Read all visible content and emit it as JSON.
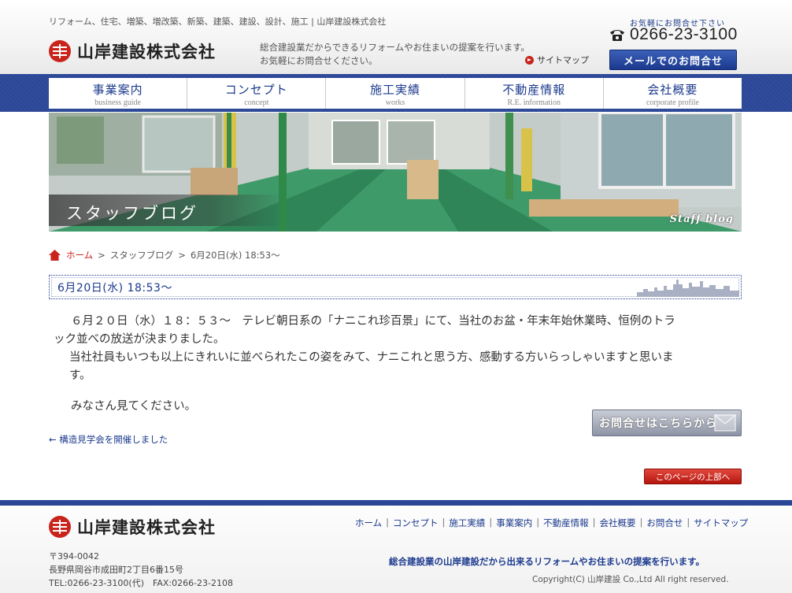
{
  "header": {
    "tagline": "リフォーム、住宅、増築、増改築、新築、建築、建設、設計、施工 | 山岸建設株式会社",
    "company_name": "山岸建設株式会社",
    "intro_line1": "総合建設業だからできるリフォームやお住まいの提案を行います。",
    "intro_line2": "お気軽にお問合せください。",
    "sitemap_label": "サイトマップ",
    "contact_prompt": "お気軽にお問合せ下さい",
    "phone": "0266-23-3100",
    "mail_button": "メールでのお問合せ"
  },
  "nav": [
    {
      "jp": "事業案内",
      "en": "business guide"
    },
    {
      "jp": "コンセプト",
      "en": "concept"
    },
    {
      "jp": "施工実績",
      "en": "works"
    },
    {
      "jp": "不動産情報",
      "en": "R.E. information"
    },
    {
      "jp": "会社概要",
      "en": "corporate profile"
    }
  ],
  "hero": {
    "title": "スタッフブログ",
    "subtitle": "Staff blog"
  },
  "breadcrumb": {
    "home": "ホーム",
    "sep": ">",
    "section": "スタッフブログ",
    "current": "6月20日(水) 18:53～"
  },
  "post": {
    "title": "6月20日(水) 18:53～",
    "para1_line1": "６月２０日（水）１８：５３～　テレビ朝日系の「ナニこれ珍百景」にて、当社のお盆・年末年始休業時、恒例のトラ",
    "para1_line2": "ック並べの放送が決まりました。",
    "para2_line1": "当社社員もいつも以上にきれいに並べられたこの姿をみて、ナニこれと思う方、感動する方いらっしゃいますと思いま",
    "para2_line2": "す。",
    "para3": "みなさん見てください。"
  },
  "prev_link": "← 構造見学会を開催しました",
  "inquiry_button": "お問合せはこちらから",
  "pagetop_button": "このページの上部へ",
  "footer": {
    "company_name": "山岸建設株式会社",
    "links": [
      "ホーム",
      "コンセプト",
      "施工実績",
      "事業案内",
      "不動産情報",
      "会社概要",
      "お問合せ",
      "サイトマップ"
    ],
    "link_sep": "|",
    "postal": "〒394-0042",
    "address": "長野県岡谷市成田町2丁目6番15号",
    "tel_fax": "TEL:0266-23-3100(代)　FAX:0266-23-2108",
    "slogan": "総合建設業の山岸建設だから出来るリフォームやお住まいの提案を行います。",
    "copyright": "Copyright(C) 山岸建設 Co.,Ltd All right reserved."
  },
  "colors": {
    "brand_red": "#c8241c",
    "brand_blue": "#1b3a8e",
    "nav_band": "#2a4696"
  }
}
